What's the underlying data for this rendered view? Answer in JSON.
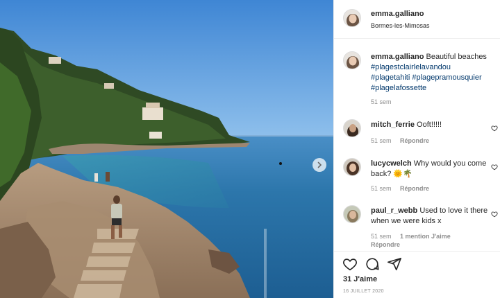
{
  "post": {
    "username": "emma.galliano",
    "location": "Bormes-les-Mimosas",
    "caption_text": "Beautiful beaches",
    "hashtags": [
      "#plagestclairlelavandou",
      "#plagetahiti",
      "#plagepramousquier",
      "#plagelafossette"
    ],
    "time": "51 sem",
    "likes": "31 J'aime",
    "date": "16 JUILLET 2020"
  },
  "comments": [
    {
      "username": "mitch_ferrie",
      "text": "Ooft!!!!!",
      "time": "51 sem",
      "reply": "Répondre",
      "likes": ""
    },
    {
      "username": "lucycwelch",
      "text": "Why would you come back? 🌞🌴",
      "time": "51 sem",
      "reply": "Répondre",
      "likes": ""
    },
    {
      "username": "paul_r_webb",
      "text": "Used to love it there when we were kids x",
      "time": "51 sem",
      "reply": "Répondre",
      "likes": "1 mention J'aime"
    }
  ],
  "icons": {
    "like": "heart-icon",
    "comment": "comment-icon",
    "share": "share-icon",
    "next": "chevron-right-icon"
  },
  "colors": {
    "text": "#262626",
    "secondary": "#8e8e8e",
    "link": "#00376b",
    "border": "#efefef",
    "sea": "#2e7fb0",
    "sky": "#4a8fd6"
  }
}
